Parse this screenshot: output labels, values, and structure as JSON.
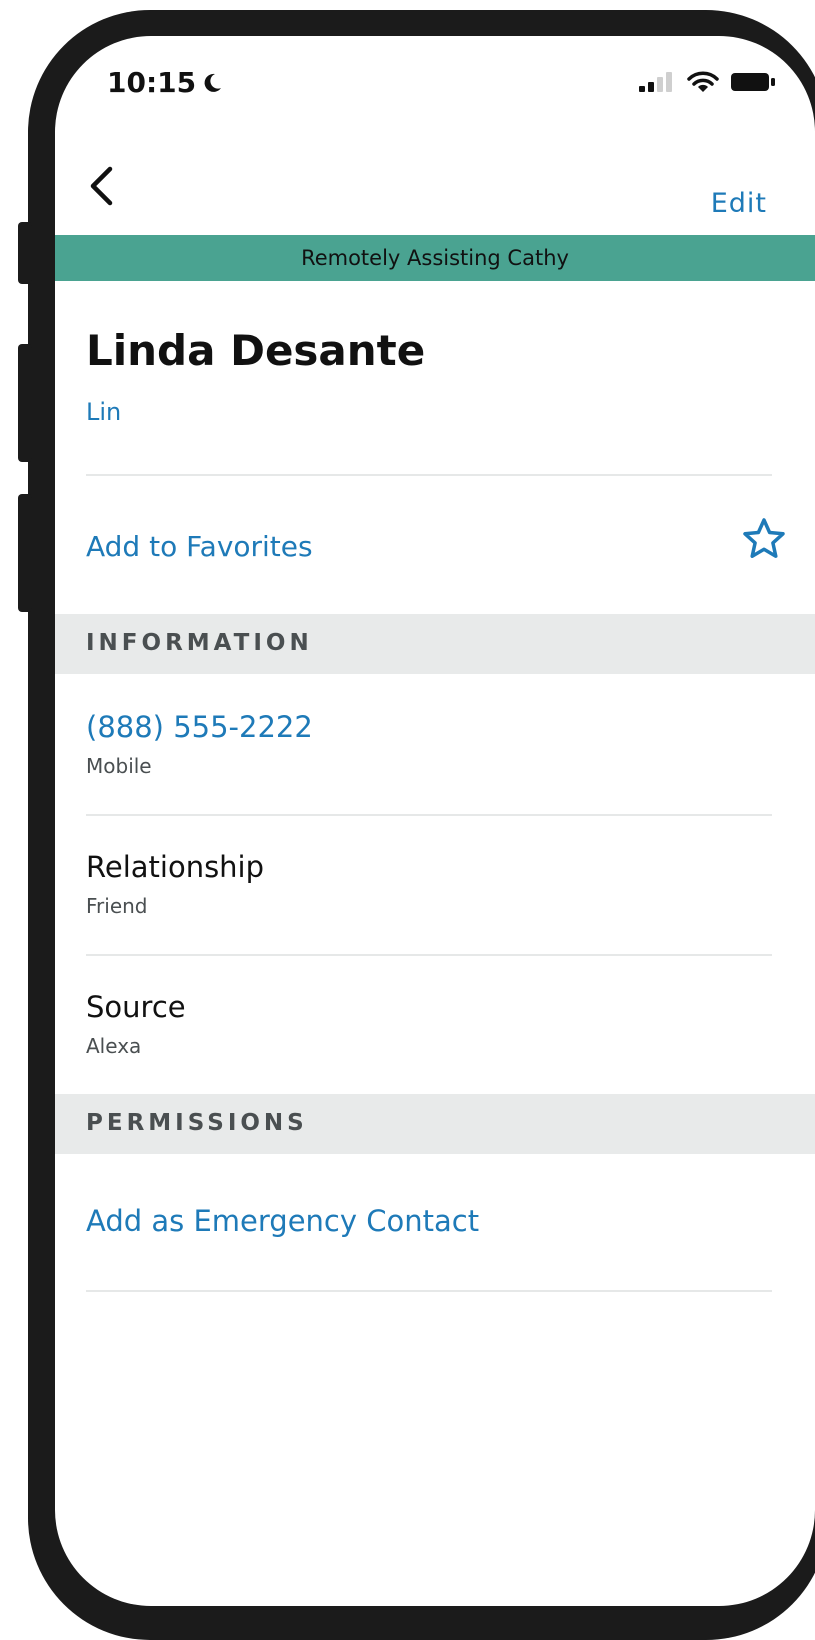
{
  "status_bar": {
    "time": "10:15"
  },
  "nav": {
    "edit_label": "Edit"
  },
  "banner": {
    "text": "Remotely Assisting Cathy"
  },
  "contact": {
    "name": "Linda Desante",
    "nickname": "Lin"
  },
  "favorites": {
    "label": "Add to Favorites"
  },
  "information": {
    "header": "INFORMATION",
    "items": [
      {
        "value": "(888) 555-2222",
        "label": "Mobile"
      },
      {
        "value": "Relationship",
        "label": "Friend"
      },
      {
        "value": "Source",
        "label": "Alexa"
      }
    ]
  },
  "permissions": {
    "header": "PERMISSIONS",
    "emergency_label": "Add as Emergency Contact"
  },
  "colors": {
    "link": "#1e7ab8",
    "banner": "#4aa391",
    "section_bg": "#e8eaea"
  }
}
